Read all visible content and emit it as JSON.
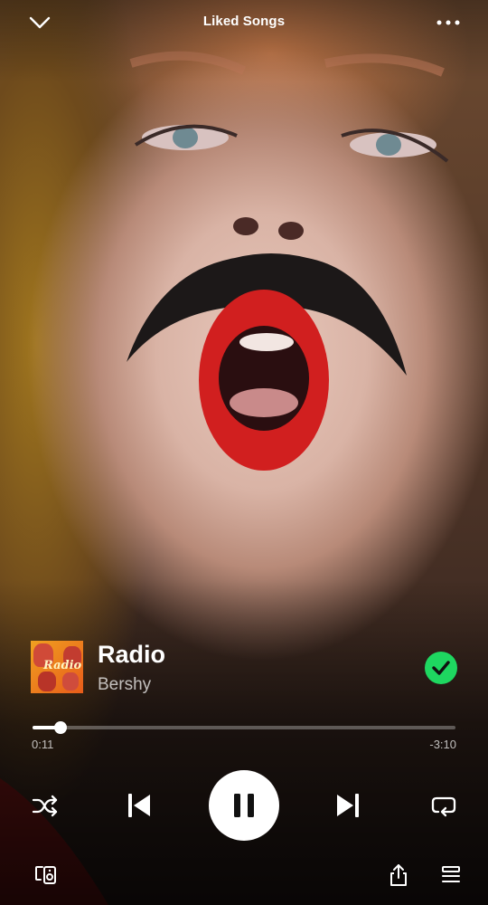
{
  "header": {
    "title": "Liked Songs",
    "collapse_icon": "chevron-down-icon",
    "menu_icon": "more-options-icon"
  },
  "track": {
    "title": "Radio",
    "artist": "Bershy",
    "cover_text": "Radio",
    "liked": true,
    "liked_color": "#1ed760"
  },
  "progress": {
    "elapsed": "0:11",
    "remaining": "-3:10",
    "fraction": 0.067
  },
  "controls": {
    "shuffle_icon": "shuffle-icon",
    "previous_icon": "skip-previous-icon",
    "play_state": "playing",
    "play_icon": "pause-icon",
    "next_icon": "skip-next-icon",
    "repeat_icon": "repeat-icon"
  },
  "bottom_bar": {
    "devices_icon": "connect-devices-icon",
    "share_icon": "share-icon",
    "queue_icon": "queue-icon"
  }
}
